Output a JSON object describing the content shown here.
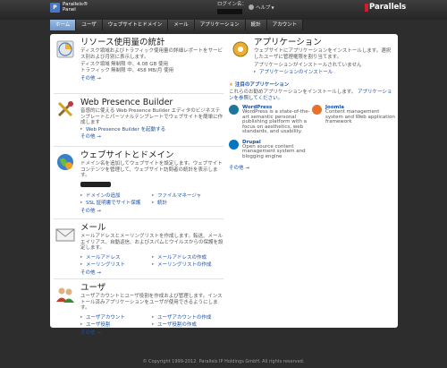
{
  "header": {
    "logo_mark": "P",
    "logo_line1": "Parallels®",
    "logo_line2": "Panel",
    "login_label": "ログイン名：",
    "help_label": "ヘルプ",
    "brand": "Parallels"
  },
  "tabs": [
    {
      "label": "ホーム"
    },
    {
      "label": "ユーザ"
    },
    {
      "label": "ウェブサイトとドメイン"
    },
    {
      "label": "メール"
    },
    {
      "label": "アプリケーション"
    },
    {
      "label": "統計"
    },
    {
      "label": "アカウント"
    }
  ],
  "sections": {
    "resources": {
      "title": "リソース使用量の統計",
      "desc": "ディスク領域およびトラフィック使用量の詳細レポートをサービス別および月別に表示します。",
      "rows": [
        {
          "label": "ディスク領域",
          "value": "無制限 中、4.08 GB 使用"
        },
        {
          "label": "トラフィック",
          "value": "無制限 中、458 MB/月 使用"
        }
      ],
      "more": "その他 →"
    },
    "wpb": {
      "title": "Web Presence Builder",
      "desc": "音感的に使える Web Presence Builder エディタのビジネステンプレートとパーソナルテンプレートでウェブサイトを簡単に作成します",
      "link": "Web Presence Builder を起動する",
      "more": "その他 →"
    },
    "websites": {
      "title": "ウェブサイトとドメイン",
      "desc": "ドメイン名を追加してウェブサイトを設定します。ウェブサイトコンテンツを管理して、ウェブサイト訪問者の統計を表示します。",
      "links": [
        "ドメインの追加",
        "ファイルマネージャ",
        "SSL 証明書でサイト保護",
        "統計"
      ],
      "more": "その他 →"
    },
    "mail": {
      "title": "メール",
      "desc": "メールアドレスとメーリングリストを作成します。転送、メールエイリアス、自動返信、およびスパムとウイルスからの保護を設定します。",
      "links": [
        "メールアドレス",
        "メールアドレスの作成",
        "メーリングリスト",
        "メーリングリストの作成"
      ],
      "more": "その他 →"
    },
    "users": {
      "title": "ユーザ",
      "desc": "ユーザアカウントとユーザ役割を作成および管理します。インストール済みアプリケーションをユーザが使用できるようにします。",
      "links": [
        "ユーザアカウント",
        "ユーザアカウントの作成",
        "ユーザ役割",
        "ユーザ役割の作成"
      ],
      "more": "その他 →"
    },
    "apps": {
      "title": "アプリケーション",
      "desc": "ウェブサイトにアプリケーションをインストールします。選択したユーザに管理権限を割り当てます。",
      "status": "アプリケーションがインストールされていません",
      "install_link": "アプリケーションのインストール"
    },
    "featured": {
      "title": "注目のアプリケーション",
      "desc": "これらのお勧めアプリケーションをインストールします。",
      "all_link": "アプリケーションを参照してください。",
      "apps": [
        {
          "name": "WordPress",
          "desc": "WordPress is a state-of-the-art semantic personal publishing platform with a focus on aesthetics, web standards, and usability.",
          "color": "#21759b",
          "icon": "wordpress-icon"
        },
        {
          "name": "Joomla",
          "desc": "Content management system and Web application framework",
          "color": "#e8722a",
          "icon": "joomla-icon"
        },
        {
          "name": "Drupal",
          "desc": "Open source content management system and blogging engine",
          "color": "#0077c0",
          "icon": "drupal-icon"
        }
      ],
      "more": "その他 →"
    }
  },
  "footer": "© Copyright 1999-2012. Parallels IP Holdings GmbH. All rights reserved."
}
